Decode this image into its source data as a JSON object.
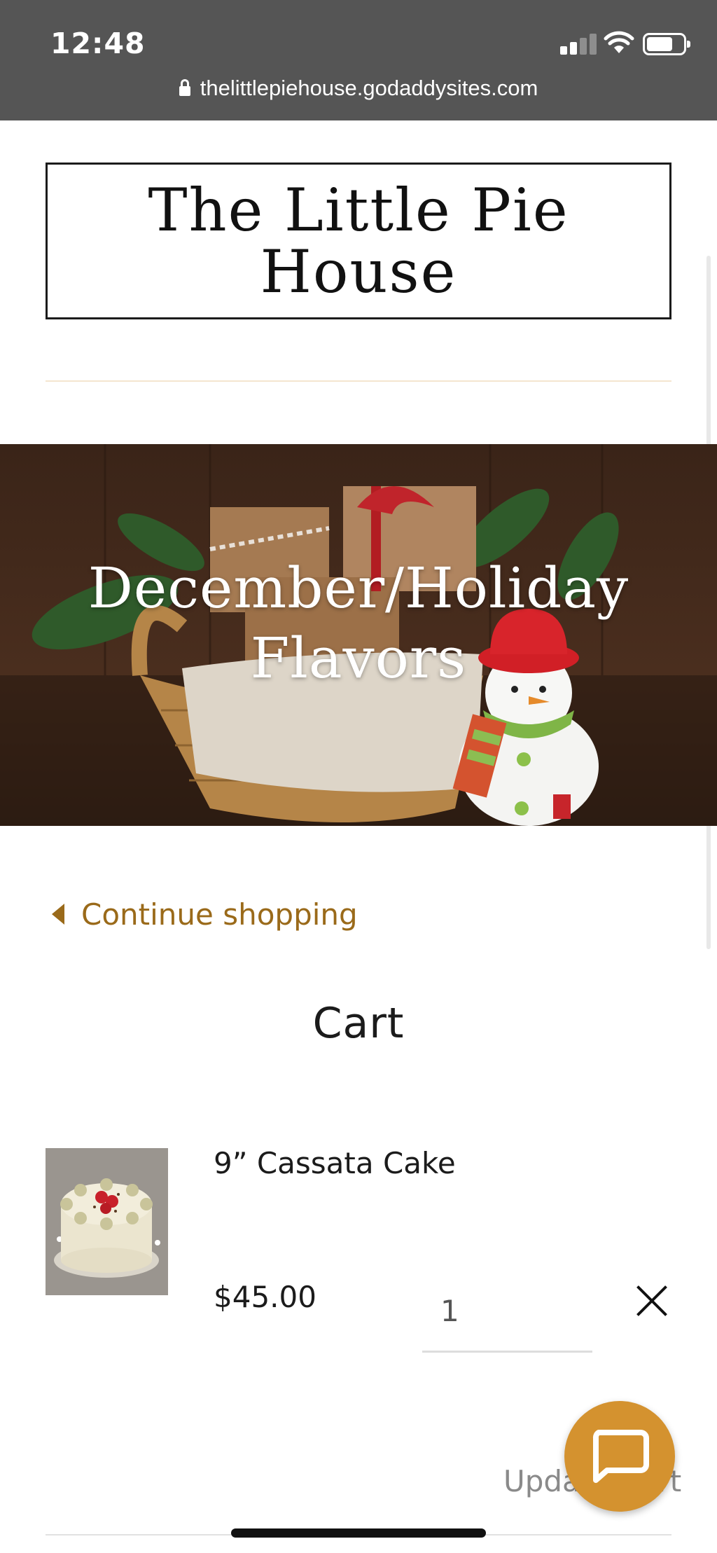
{
  "status_bar": {
    "time": "12:48",
    "url": "thelittlepiehouse.godaddysites.com"
  },
  "site": {
    "logo_line1": "The Little Pie",
    "logo_line2": "House"
  },
  "hero": {
    "title_line1": "December/Holiday",
    "title_line2": "Flavors",
    "image": "holiday-basket-snowman-photo"
  },
  "nav": {
    "continue_label": "Continue shopping"
  },
  "cart": {
    "title": "Cart",
    "items": [
      {
        "name": "9” Cassata Cake",
        "price": "$45.00",
        "quantity": "1",
        "thumbnail": "cassata-cake-photo"
      }
    ],
    "update_label": "Update Cart"
  },
  "icons": {
    "back": "caret-left-icon",
    "remove": "close-icon",
    "chat": "chat-bubble-icon"
  },
  "colors": {
    "accent": "#9a6a1a",
    "chat_button": "#d4922f",
    "status_bar": "#555555"
  }
}
